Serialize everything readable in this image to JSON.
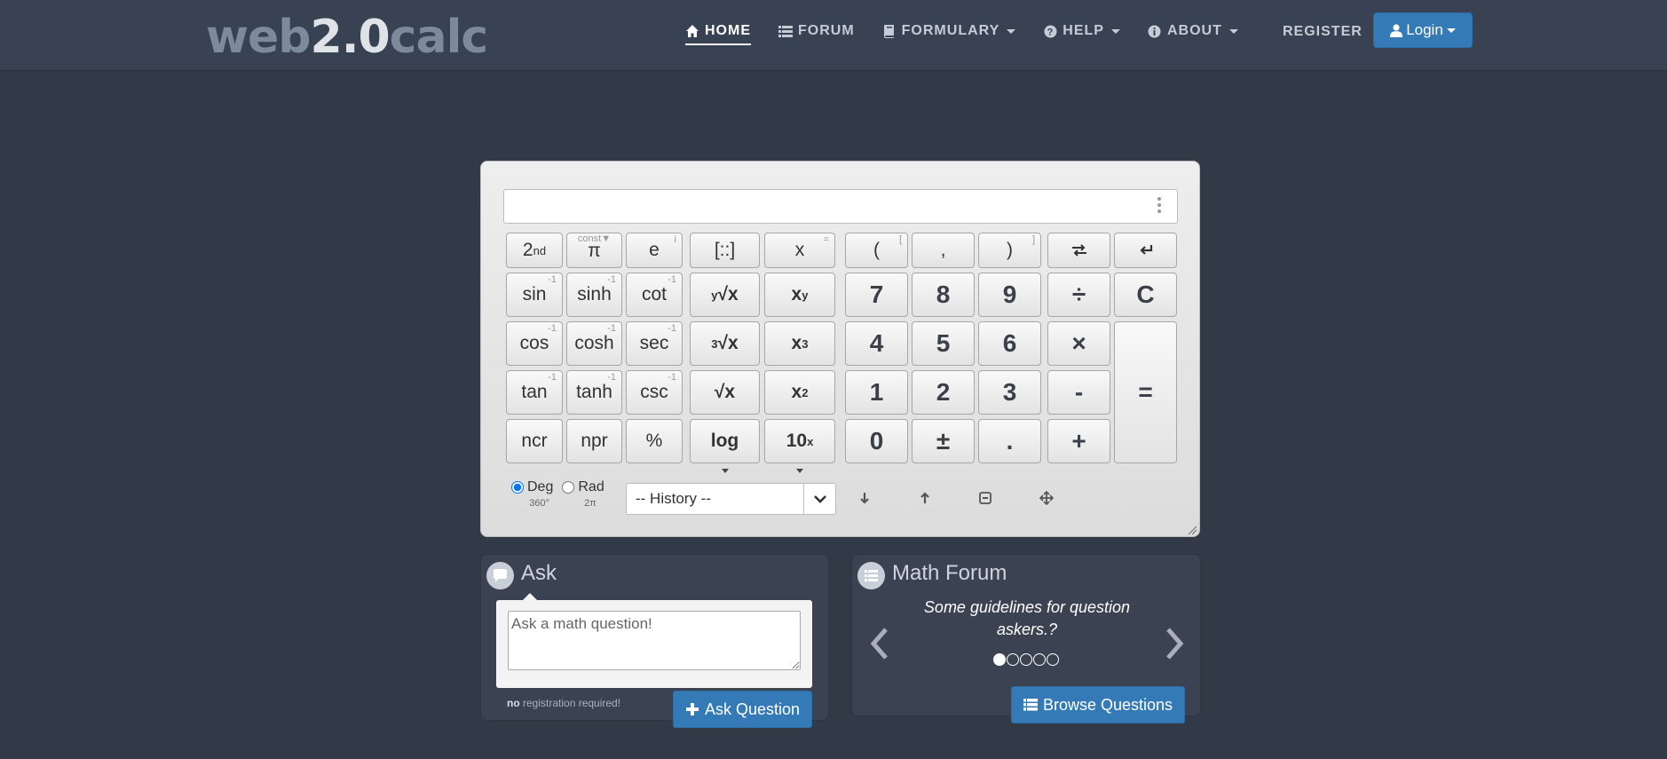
{
  "logo": {
    "part1": "web",
    "part2": "2.0",
    "part3": "calc"
  },
  "nav": {
    "items": [
      {
        "label": "HOME",
        "icon": "home-icon"
      },
      {
        "label": "FORUM",
        "icon": "list-icon"
      },
      {
        "label": "FORMULARY",
        "icon": "book-icon"
      },
      {
        "label": "HELP",
        "icon": "question-circle-icon"
      },
      {
        "label": "ABOUT",
        "icon": "info-circle-icon"
      }
    ],
    "register": "REGISTER",
    "login": "Login"
  },
  "calculator": {
    "keys": {
      "second": "2",
      "second_sup": "nd",
      "pi": "π",
      "pi_const": "const▼",
      "e": "e",
      "e_sup": "i",
      "matrix": "[::]",
      "x": "x",
      "x_sup": "=",
      "lparen": "(",
      "lparen_sup": "[",
      "comma": ",",
      "rparen": ")",
      "rparen_sup": "]",
      "sin": "sin",
      "sinh": "sinh",
      "cot": "cot",
      "cos": "cos",
      "cosh": "cosh",
      "sec": "sec",
      "tan": "tan",
      "tanh": "tanh",
      "csc": "csc",
      "inverse_sup": "-1",
      "yroot_pre": "y",
      "yroot": "√x",
      "xpow": "x",
      "xpow_sup": "y",
      "croot_pre": "3",
      "croot": "√x",
      "xcube": "x",
      "xcube_sup": "3",
      "sqrt": "√x",
      "xsq": "x",
      "xsq_sup": "2",
      "ncr": "ncr",
      "npr": "npr",
      "percent": "%",
      "log": "log",
      "tenpow": "10",
      "tenpow_sup": "x",
      "seven": "7",
      "eight": "8",
      "nine": "9",
      "four": "4",
      "five": "5",
      "six": "6",
      "one": "1",
      "two": "2",
      "three": "3",
      "zero": "0",
      "plusminus": "±",
      "dot": ".",
      "divide": "÷",
      "multiply": "×",
      "minus": "-",
      "plus": "+",
      "clear": "C",
      "equals": "="
    },
    "angle": {
      "deg": "Deg",
      "deg_sub": "360°",
      "rad": "Rad",
      "rad_sub": "2π",
      "selected": "Deg"
    },
    "history": "-- History --"
  },
  "ask": {
    "title": "Ask",
    "placeholder": "Ask a math question!",
    "noreg_bold": "no",
    "noreg_rest": " registration required!",
    "button": "Ask Question"
  },
  "forum": {
    "title": "Math Forum",
    "text": "Some guidelines for question askers.?",
    "slides": 5,
    "active_slide": 1,
    "button": "Browse Questions"
  }
}
